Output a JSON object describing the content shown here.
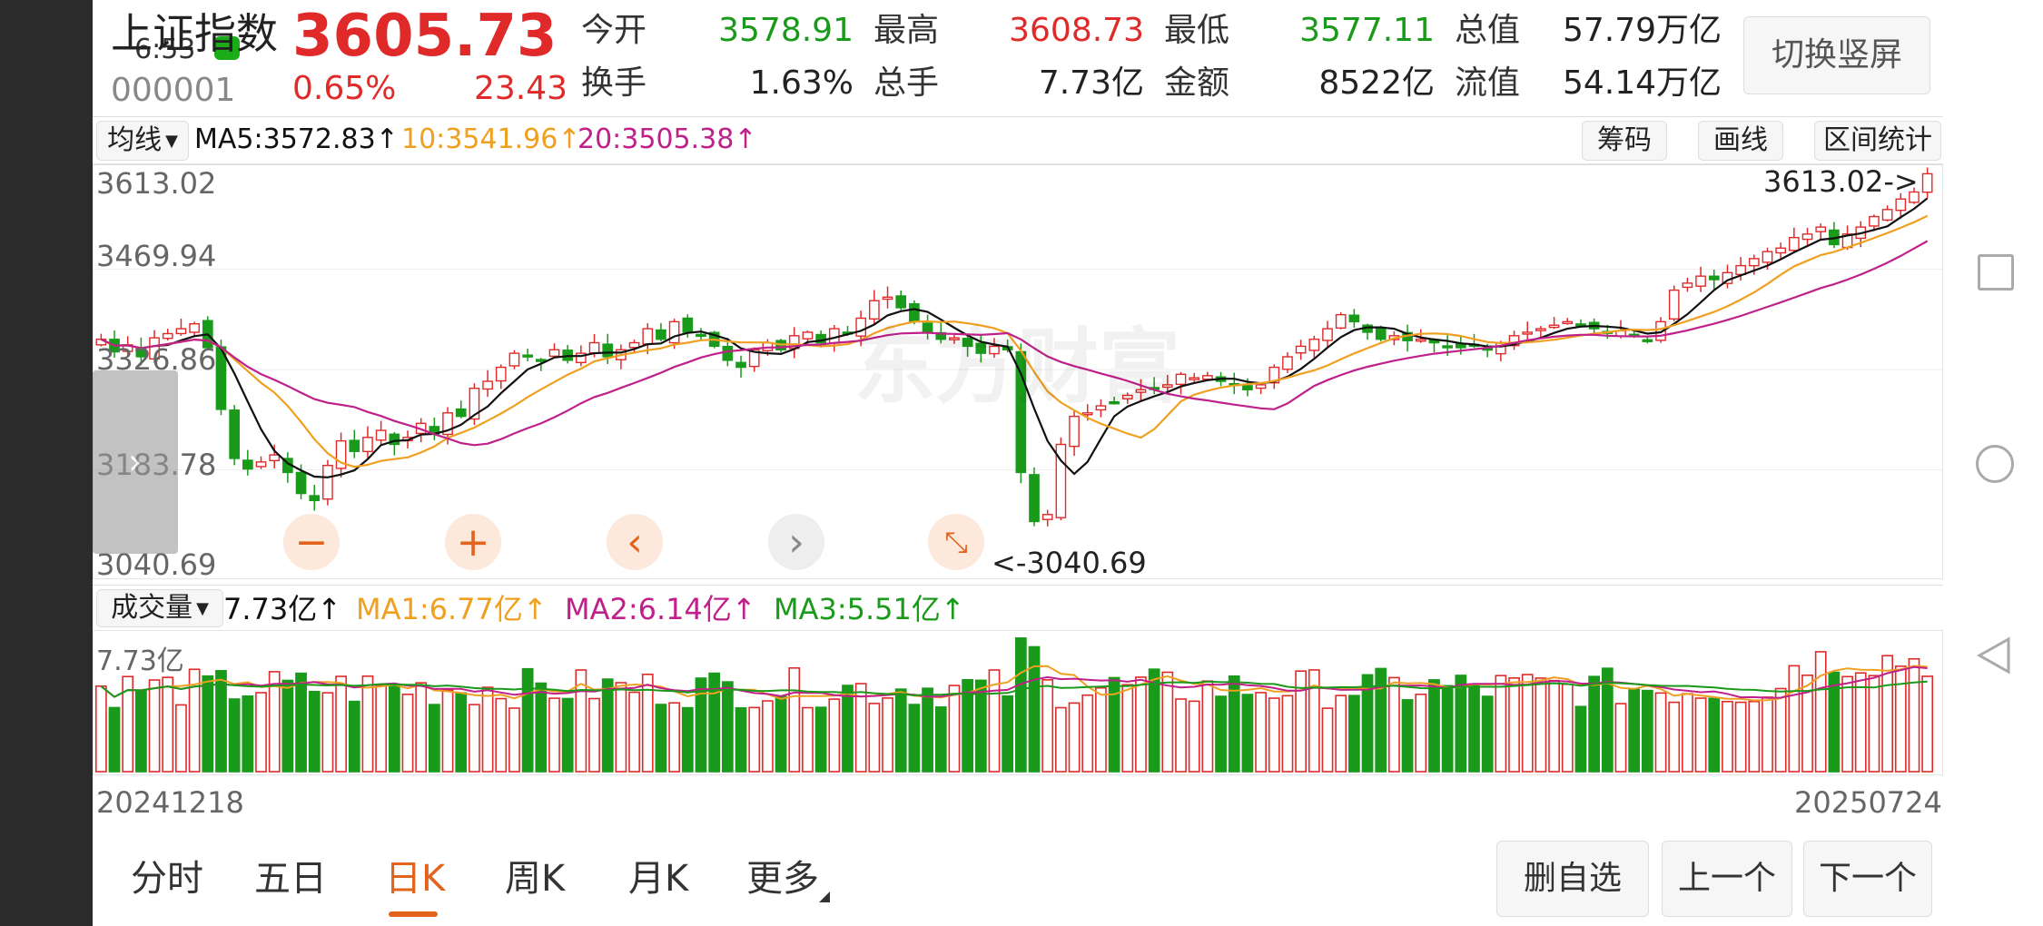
{
  "status": {
    "time": "6:53"
  },
  "quote": {
    "name": "上证指数",
    "code": "000001",
    "price": "3605.73",
    "change_pct": "0.65%",
    "change_abs": "23.43",
    "fields": [
      {
        "label": "今开",
        "value": "3578.91",
        "color": "green"
      },
      {
        "label": "最高",
        "value": "3608.73",
        "color": "red"
      },
      {
        "label": "最低",
        "value": "3577.11",
        "color": "green"
      },
      {
        "label": "总值",
        "value": "57.79万亿",
        "color": "dark"
      },
      {
        "label": "换手",
        "value": "1.63%",
        "color": "dark"
      },
      {
        "label": "总手",
        "value": "7.73亿",
        "color": "dark"
      },
      {
        "label": "金额",
        "value": "8522亿",
        "color": "dark"
      },
      {
        "label": "流值",
        "value": "54.14万亿",
        "color": "dark"
      }
    ],
    "switch_button": "切换竖屏"
  },
  "ma_bar": {
    "selector": "均线",
    "ma5": "MA5:3572.83↑",
    "ma10": "10:3541.96↑",
    "ma20": "20:3505.38↑",
    "buttons": [
      "筹码",
      "画线",
      "区间统计"
    ]
  },
  "price_chart": {
    "y_labels": [
      "3613.02",
      "3469.94",
      "3326.86",
      "3183.78",
      "3040.69"
    ],
    "high_label": "3613.02->",
    "low_label": "<-3040.69",
    "watermark": "东方财富"
  },
  "volume_bar": {
    "selector": "成交量",
    "current": "7.73亿↑",
    "ma1": "MA1:6.77亿↑",
    "ma2": "MA2:6.14亿↑",
    "ma3": "MA3:5.51亿↑",
    "axis_label": "7.73亿"
  },
  "dates": {
    "start": "20241218",
    "end": "20250724"
  },
  "tabs": [
    "分时",
    "五日",
    "日K",
    "周K",
    "月K",
    "更多"
  ],
  "active_tab": "日K",
  "bottom_buttons": [
    "删自选",
    "上一个",
    "下一个"
  ],
  "colors": {
    "up": "#e02a2a",
    "down": "#1a9a1a",
    "ma5": "#111111",
    "ma10": "#f0a020",
    "ma20": "#c0208a",
    "ma3": "#1a9a1a",
    "accent": "#e2641c"
  },
  "chart_data": {
    "type": "candlestick",
    "ylim": [
      3040.69,
      3613.02
    ],
    "closes": [
      3370,
      3352,
      3362,
      3345,
      3372,
      3378,
      3385,
      3392,
      3358,
      3270,
      3200,
      3185,
      3195,
      3205,
      3180,
      3150,
      3140,
      3190,
      3225,
      3210,
      3230,
      3240,
      3220,
      3230,
      3250,
      3235,
      3265,
      3260,
      3300,
      3310,
      3330,
      3350,
      3345,
      3340,
      3355,
      3340,
      3350,
      3365,
      3345,
      3355,
      3365,
      3385,
      3370,
      3395,
      3380,
      3375,
      3360,
      3340,
      3330,
      3355,
      3365,
      3355,
      3375,
      3380,
      3365,
      3385,
      3380,
      3400,
      3425,
      3430,
      3415,
      3395,
      3380,
      3370,
      3372,
      3360,
      3350,
      3360,
      3355,
      3180,
      3110,
      3120,
      3220,
      3260,
      3265,
      3275,
      3280,
      3290,
      3298,
      3300,
      3305,
      3320,
      3315,
      3318,
      3310,
      3305,
      3298,
      3305,
      3330,
      3345,
      3360,
      3370,
      3385,
      3405,
      3395,
      3380,
      3370,
      3375,
      3368,
      3370,
      3365,
      3360,
      3358,
      3360,
      3355,
      3365,
      3375,
      3380,
      3385,
      3390,
      3395,
      3390,
      3385,
      3380,
      3382,
      3375,
      3368,
      3395,
      3440,
      3450,
      3460,
      3455,
      3465,
      3475,
      3485,
      3495,
      3500,
      3515,
      3520,
      3530,
      3505,
      3520,
      3530,
      3545,
      3555,
      3570,
      3580,
      3606
    ],
    "ma5_last": 3572.83,
    "ma10_last": 3541.96,
    "ma20_last": 3505.38
  }
}
